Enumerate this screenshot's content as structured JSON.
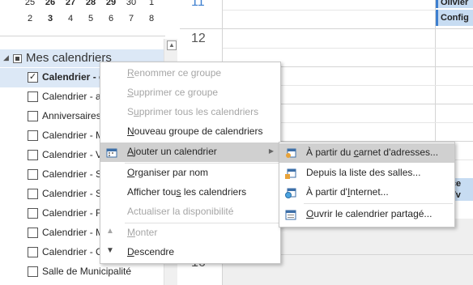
{
  "mini_calendar": {
    "row1": [
      "25",
      "26",
      "27",
      "28",
      "29",
      "30",
      "1"
    ],
    "row2": [
      "2",
      "3",
      "4",
      "5",
      "6",
      "7",
      "8"
    ],
    "bold1": [
      false,
      true,
      true,
      true,
      true,
      false,
      false
    ],
    "bold2": [
      false,
      true,
      false,
      false,
      false,
      false,
      false
    ]
  },
  "sidebar": {
    "group_label": "Mes calendriers",
    "items": [
      {
        "label": "Calendrier - c",
        "checked": true
      },
      {
        "label": "Calendrier - a",
        "checked": false
      },
      {
        "label": "Anniversaires",
        "checked": false
      },
      {
        "label": "Calendrier - M",
        "checked": false
      },
      {
        "label": "Calendrier - V",
        "checked": false
      },
      {
        "label": "Calendrier - S",
        "checked": false
      },
      {
        "label": "Calendrier - S",
        "checked": false
      },
      {
        "label": "Calendrier - F",
        "checked": false
      },
      {
        "label": "Calendrier - M",
        "checked": false
      },
      {
        "label": "Calendrier - C",
        "checked": false
      },
      {
        "label": "Salle de Municipalité",
        "checked": false
      }
    ]
  },
  "grid": {
    "hours": [
      "11",
      "12",
      "16"
    ],
    "events": [
      "Olivier",
      "Config",
      "ance",
      "le Yv"
    ]
  },
  "context_menu": {
    "items": [
      {
        "label": "Renommer ce groupe",
        "ul": "R",
        "disabled": true
      },
      {
        "label": "Supprimer ce groupe",
        "ul": "S",
        "disabled": true
      },
      {
        "label": "Supprimer tous les calendriers",
        "ul": "u",
        "disabled": true
      },
      {
        "label": "Nouveau groupe de calendriers",
        "ul": "N",
        "disabled": false
      },
      {
        "label": "Ajouter un calendrier",
        "ul": "A",
        "disabled": false
      },
      {
        "label": "Organiser par nom",
        "ul": "O",
        "disabled": false
      },
      {
        "label": "Afficher tous les calendriers",
        "ul": "s",
        "disabled": false
      },
      {
        "label": "Actualiser la disponibilité",
        "ul": "",
        "disabled": true
      },
      {
        "label": "Monter",
        "ul": "M",
        "disabled": true
      },
      {
        "label": "Descendre",
        "ul": "D",
        "disabled": false
      }
    ]
  },
  "submenu": {
    "items": [
      {
        "label": "À partir du carnet d'adresses...",
        "ul": "c"
      },
      {
        "label": "Depuis la liste des salles...",
        "ul": ""
      },
      {
        "label": "À partir d'Internet...",
        "ul": "I"
      },
      {
        "label": "Ouvrir le calendrier partagé...",
        "ul": "O"
      }
    ]
  },
  "colors": {
    "selection": "#dce8f6",
    "highlight": "#d0d0d0",
    "event_fill": "#c7dcf2",
    "event_border": "#3d7fcf"
  }
}
